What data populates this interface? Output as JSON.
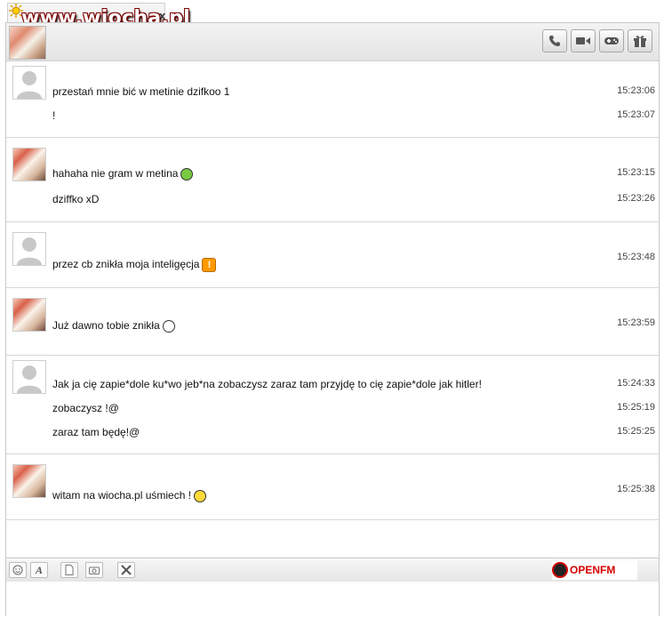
{
  "watermark": "www.wiocha.pl",
  "tab": {
    "close_glyph": "x"
  },
  "header": {
    "buttons": [
      {
        "icon": "phone-icon"
      },
      {
        "icon": "video-camera-icon"
      },
      {
        "icon": "gamepad-icon"
      },
      {
        "icon": "gift-icon"
      }
    ]
  },
  "messages": [
    {
      "sender": "other",
      "lines": [
        {
          "text": "przestań mnie bić w metinie dzifkoo 1",
          "time": "15:23:06"
        },
        {
          "text": "!",
          "time": "15:23:07"
        }
      ]
    },
    {
      "sender": "me",
      "lines": [
        {
          "text": "hahaha nie gram w metina",
          "time": "15:23:15",
          "emoticon": "laughing-emoticon-icon"
        },
        {
          "text": "dziffko xD",
          "time": "15:23:26"
        }
      ]
    },
    {
      "sender": "other",
      "lines": [
        {
          "text": "przez cb znikła moja inteligęcja",
          "time": "15:23:48",
          "emoticon": "exclamation-emoticon-icon"
        }
      ]
    },
    {
      "sender": "me",
      "lines": [
        {
          "text": "Już dawno tobie znikła",
          "time": "15:23:59",
          "emoticon": "grin-emoticon-icon"
        }
      ]
    },
    {
      "sender": "other",
      "lines": [
        {
          "text": "Jak ja cię zapie*dole ku*wo jeb*na zobaczysz zaraz tam przyjdę to cię zapie*dole  jak hitler!",
          "time": "15:24:33"
        },
        {
          "text": "zobaczysz !@",
          "time": "15:25:19"
        },
        {
          "text": "zaraz tam będę!@",
          "time": "15:25:25"
        }
      ]
    },
    {
      "sender": "me",
      "lines": [
        {
          "text": "witam na wiocha.pl uśmiech !",
          "time": "15:25:38",
          "emoticon": "smile-emoticon-icon"
        }
      ]
    }
  ],
  "toolbar": {
    "buttons": [
      "smiley-icon",
      "font-icon",
      "file-icon",
      "camera-icon",
      "tools-icon"
    ],
    "radio_brand": "OPENFM"
  },
  "colors": {
    "accent": "#d40000",
    "border": "#c9c9c9"
  }
}
